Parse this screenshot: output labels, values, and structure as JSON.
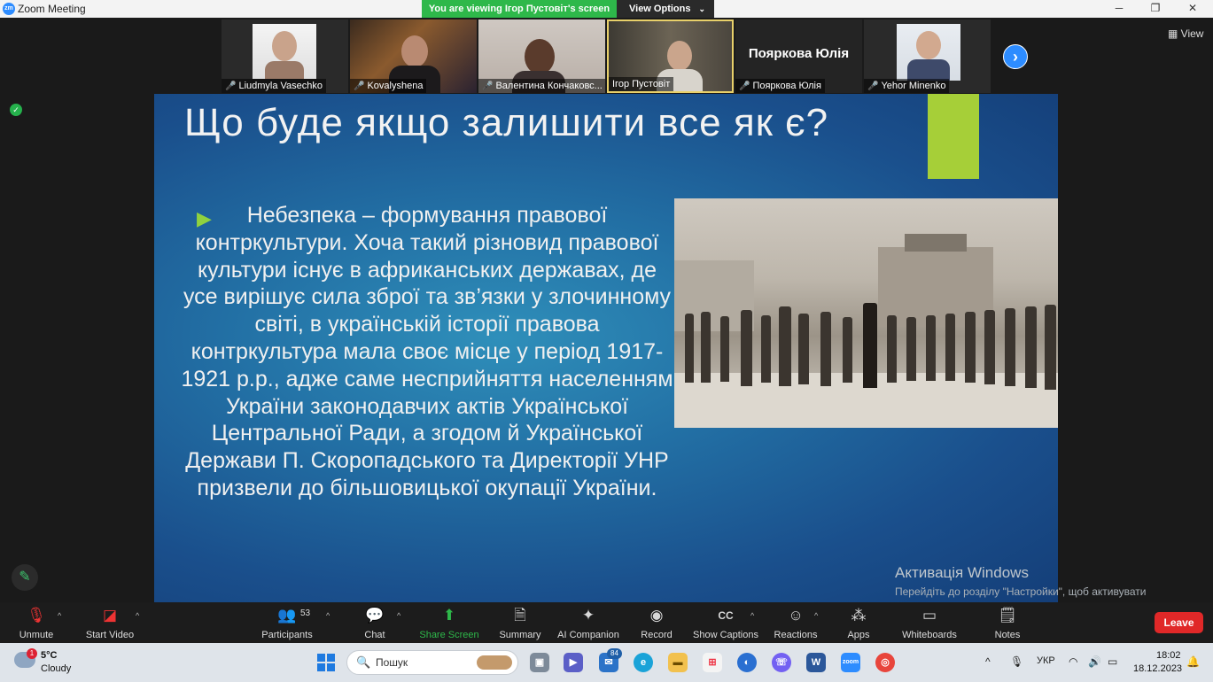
{
  "window": {
    "title": "Zoom Meeting",
    "app_icon": "zm"
  },
  "share_banner": {
    "text": "You are viewing Ігор Пустовіт's screen",
    "view_options": "View Options"
  },
  "window_controls": {
    "minimize": "─",
    "restore": "❐",
    "close": "✕"
  },
  "participants": [
    {
      "name": "Liudmyla Vasechko",
      "muted": true
    },
    {
      "name": "Kovalyshena",
      "muted": true
    },
    {
      "name": "Валентина Кончаковс...",
      "muted": true
    },
    {
      "name": "Ігор Пустовіт",
      "muted": false,
      "active_speaker": true
    },
    {
      "name": "Пояркова Юлія",
      "muted": true,
      "display_name": "Пояркова Юлія"
    },
    {
      "name": "Yehor Minenko",
      "muted": true
    }
  ],
  "gallery": {
    "next_icon": "›",
    "view_label": "View"
  },
  "slide": {
    "title": "Що буде якщо залишити все як є?",
    "bullet_icon": "▶",
    "body": "Небезпека – формування правової контркультури. Хоча такий різновид правової культури існує в африканських державах, де усе вирішує сила зброї та зв’язки у злочинному світі, в українській історії правова контркультура мала своє місце у період 1917-1921 р.р., адже саме несприйняття населенням України законодавчих актів Української Центральної Ради, а згодом й Української Держави П. Скоропадського та Директорії УНР призвели до більшовицької окупації України.",
    "accent_color": "#a6cf38"
  },
  "activation": {
    "title": "Активація Windows",
    "subtitle": "Перейдіть до розділу \"Настройки\", щоб активувати Windows."
  },
  "toolbar": {
    "unmute": "Unmute",
    "start_video": "Start Video",
    "participants": "Participants",
    "participants_count": "53",
    "chat": "Chat",
    "share_screen": "Share Screen",
    "summary": "Summary",
    "ai_companion": "AI Companion",
    "record": "Record",
    "show_captions": "Show Captions",
    "reactions": "Reactions",
    "apps": "Apps",
    "whiteboards": "Whiteboards",
    "notes": "Notes",
    "leave": "Leave"
  },
  "taskbar": {
    "weather_temp": "5°C",
    "weather_desc": "Cloudy",
    "weather_badge": "1",
    "search_placeholder": "Пошук",
    "mail_badge": "84",
    "language": "УКР",
    "time": "18:02",
    "date": "18.12.2023"
  }
}
